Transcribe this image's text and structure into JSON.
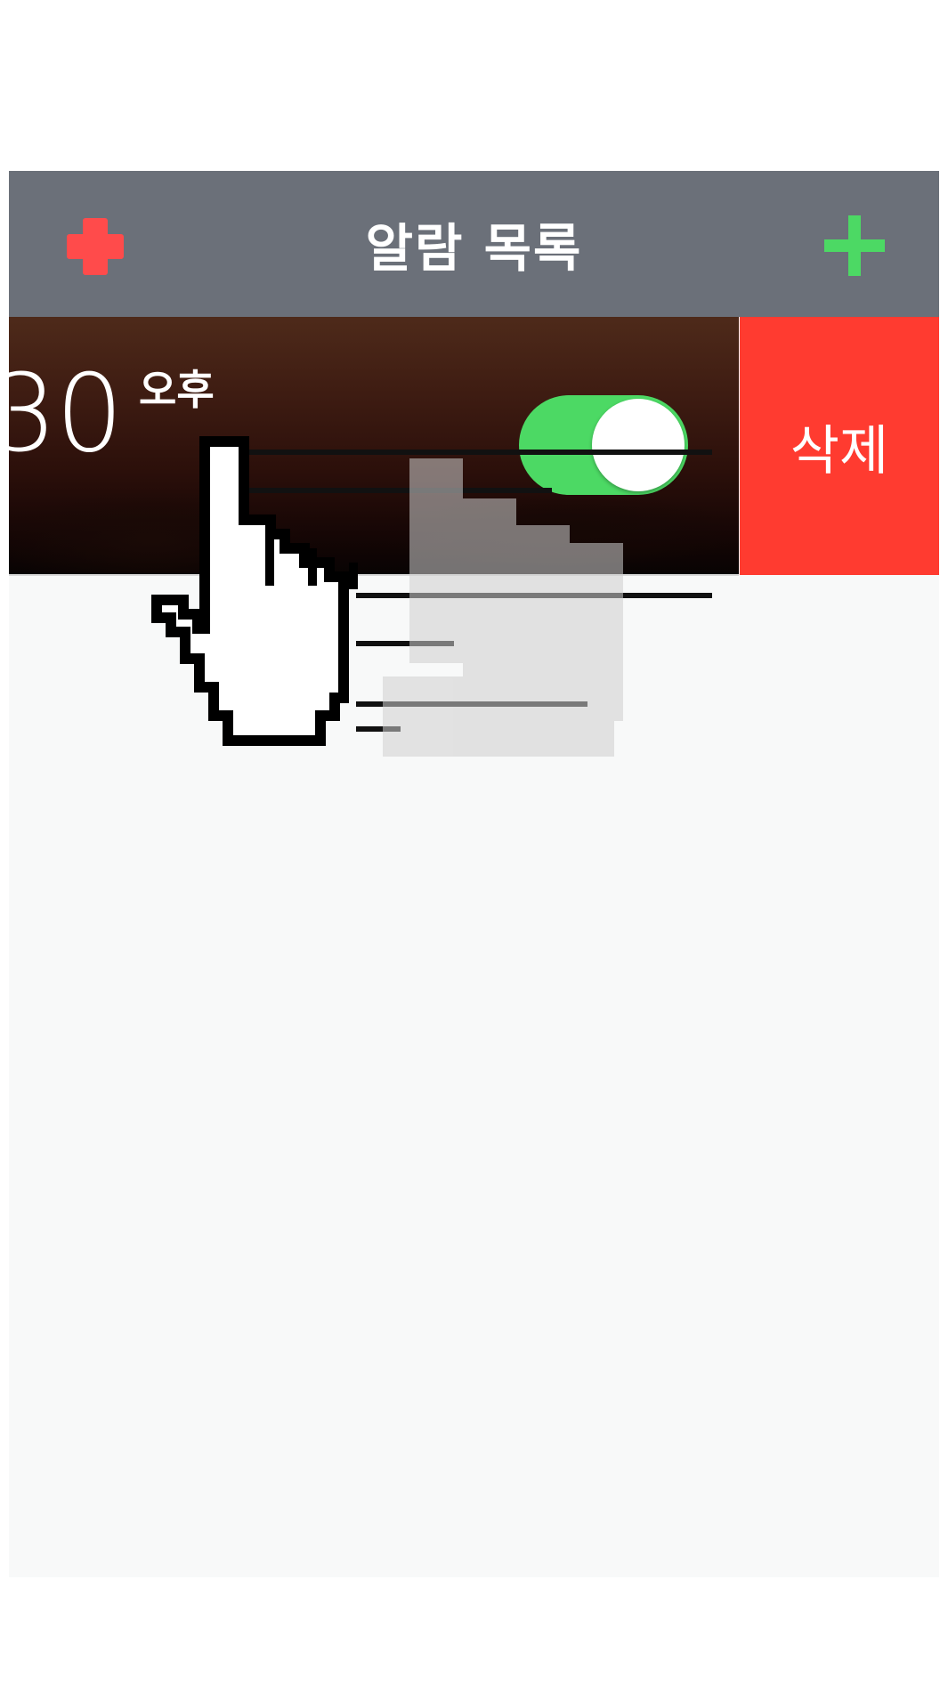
{
  "nav": {
    "title": "알람 목록",
    "left_icon": "medical-cross-icon",
    "right_icon": "plus-icon",
    "left_icon_color": "#ff4b4b",
    "right_icon_color": "#4cd964",
    "bar_color": "#6b7079"
  },
  "alarm": {
    "time": "30",
    "ampm": "오후",
    "enabled": true,
    "toggle_color": "#4cd964"
  },
  "actions": {
    "delete_label": "삭제",
    "delete_color": "#ff3b30"
  },
  "overlay": {
    "cursor_icon": "hand-pointer-icon"
  }
}
